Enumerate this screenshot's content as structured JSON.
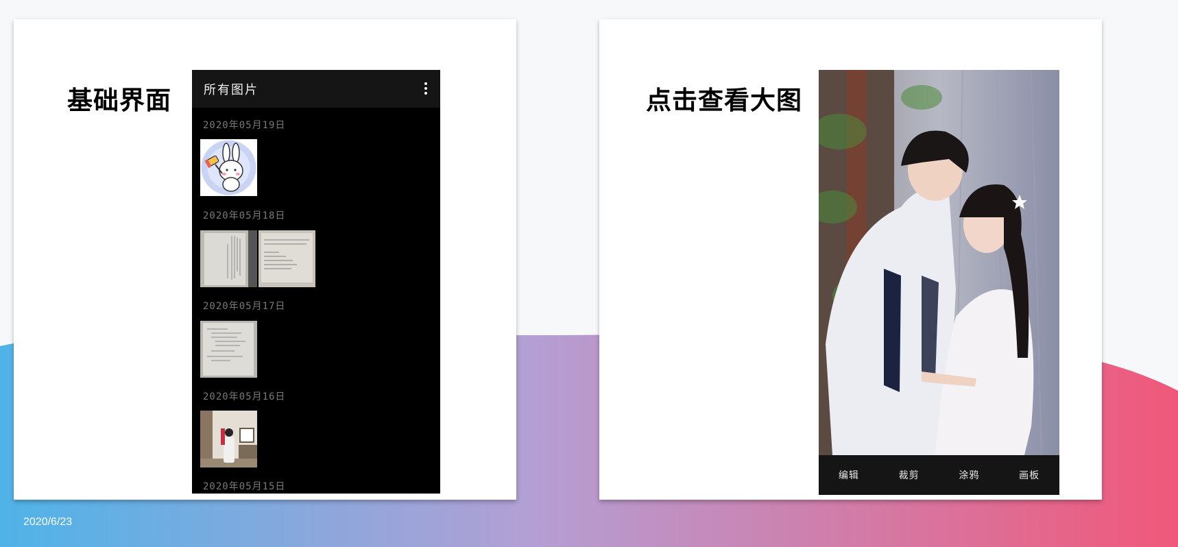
{
  "footer": {
    "date": "2020/6/23"
  },
  "colors": {
    "gradient_left": "#4fb3e8",
    "gradient_mid": "#b39fd4",
    "gradient_right": "#f0587a",
    "card": "#ffffff",
    "phone_bg": "#000000",
    "app_bar": "#151515"
  },
  "left_panel": {
    "title": "基础界面",
    "app": {
      "title": "所有图片",
      "menu_icon": "more-vertical-icon",
      "groups": [
        {
          "date": "2020年05月19日",
          "thumbnails": [
            "rabbit-sticker"
          ]
        },
        {
          "date": "2020年05月18日",
          "thumbnails": [
            "document-photo",
            "document-photo"
          ]
        },
        {
          "date": "2020年05月17日",
          "thumbnails": [
            "document-photo"
          ]
        },
        {
          "date": "2020年05月16日",
          "thumbnails": [
            "room-photo"
          ]
        },
        {
          "date": "2020年05月15日",
          "thumbnails": []
        }
      ]
    }
  },
  "right_panel": {
    "title": "点击查看大图",
    "viewer": {
      "photo": "couple-photo",
      "actions": [
        "编辑",
        "裁剪",
        "涂鸦",
        "画板"
      ]
    }
  }
}
